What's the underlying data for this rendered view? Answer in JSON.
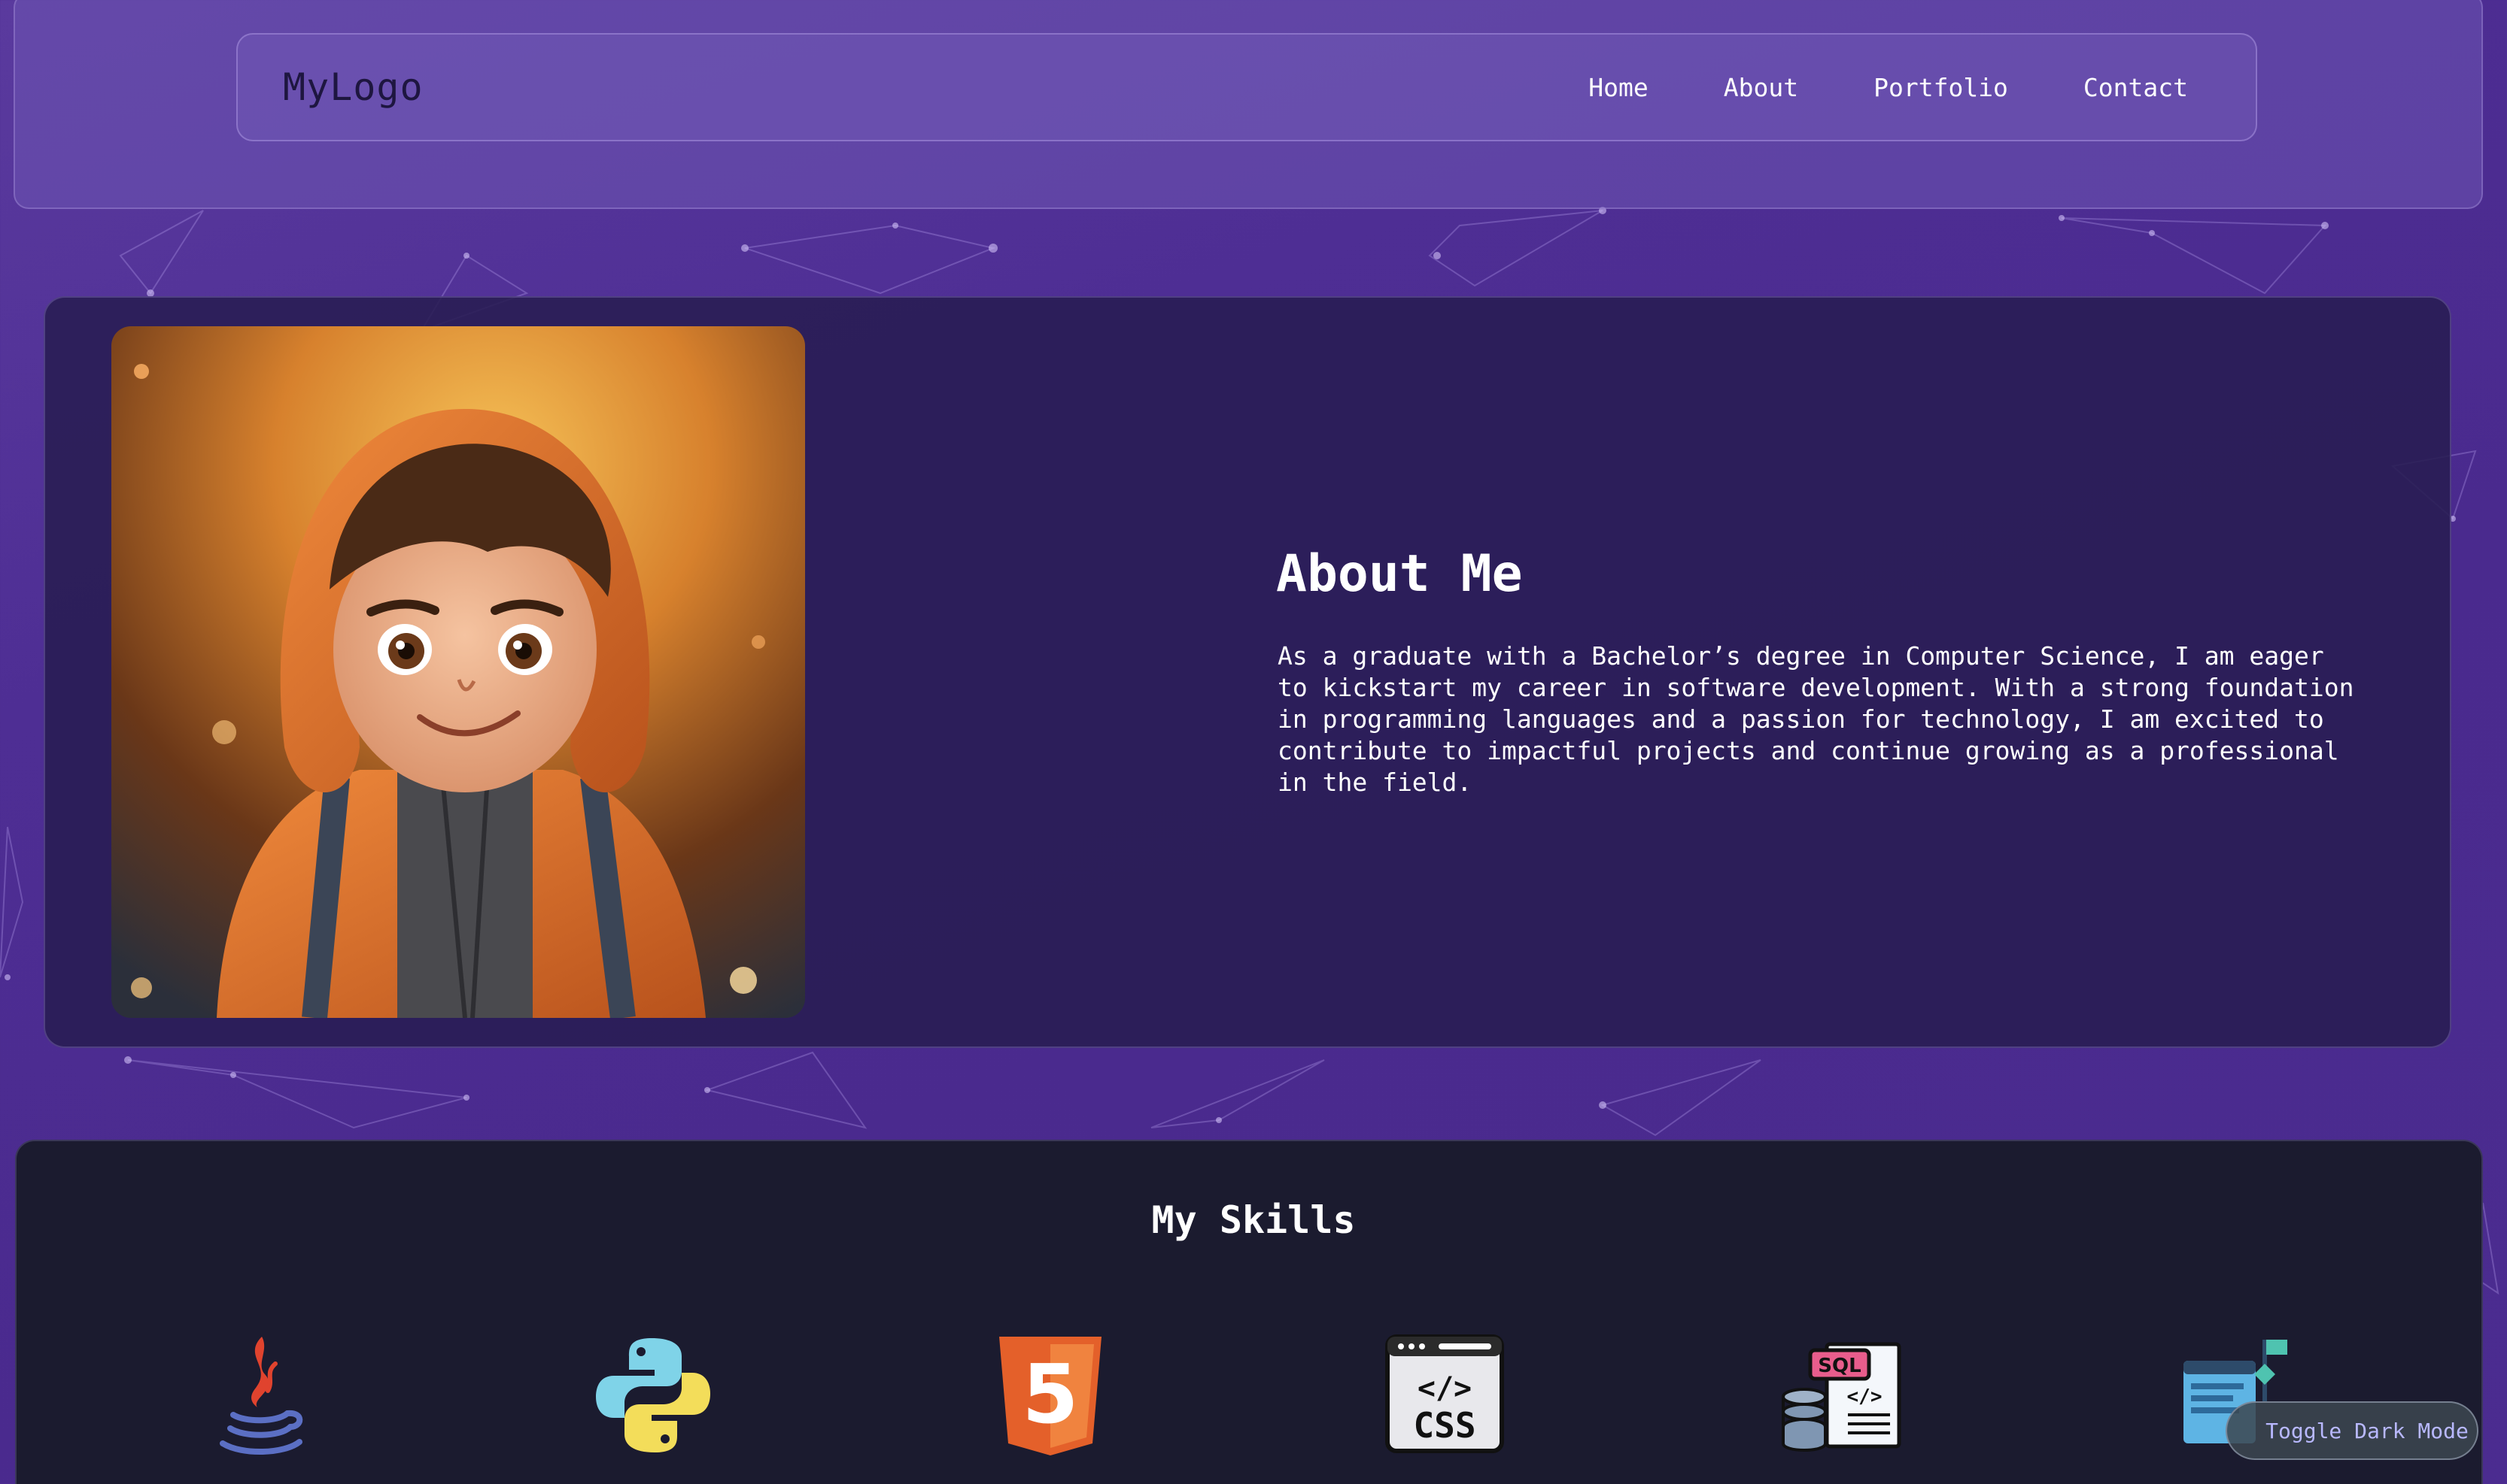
{
  "header": {
    "logo": "MyLogo",
    "nav": [
      "Home",
      "About",
      "Portfolio",
      "Contact"
    ]
  },
  "about": {
    "title": "About Me",
    "text": "As a graduate with a Bachelor’s degree in Computer Science, I am eager to kickstart my career in software development. With a strong foundation in programming languages and a passion for technology, I am excited to contribute to impactful projects and continue growing as a professional in the field.",
    "avatar_icon": "avatar-illustration"
  },
  "skills": {
    "title": "My Skills",
    "items": [
      {
        "name": "java",
        "icon": "java-icon"
      },
      {
        "name": "python",
        "icon": "python-icon"
      },
      {
        "name": "html5",
        "icon": "html5-icon",
        "label": "5"
      },
      {
        "name": "css",
        "icon": "css-icon",
        "label": "CSS",
        "code": "</>"
      },
      {
        "name": "sql",
        "icon": "sql-icon",
        "label": "SQL",
        "code": "</>"
      },
      {
        "name": "web-dev",
        "icon": "web-dev-icon"
      }
    ]
  },
  "toggle": {
    "label": "Toggle Dark Mode"
  },
  "colors": {
    "background": "#4e2e94",
    "about_card": "#281c52",
    "skills_card": "#1b1b2f",
    "toggle_text": "#b8b8ff"
  }
}
